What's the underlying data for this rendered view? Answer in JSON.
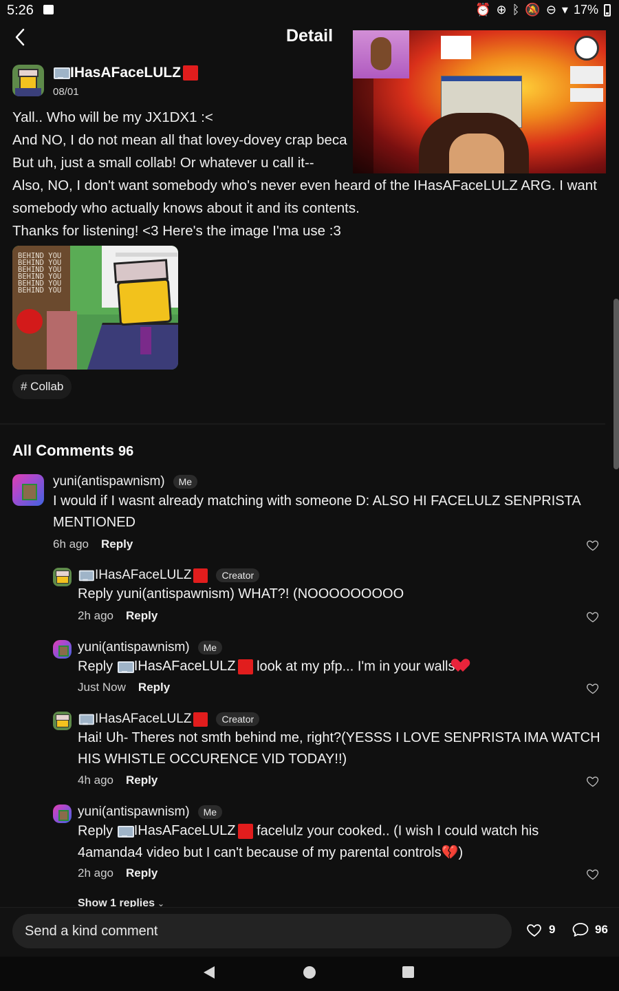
{
  "status_bar": {
    "time": "5:26",
    "battery": "17%",
    "icons": [
      "gallery-icon",
      "alarm-icon",
      "sync-icon",
      "bluetooth-icon",
      "bell-off-icon",
      "dnd-icon",
      "wifi-icon",
      "battery-icon"
    ]
  },
  "header": {
    "title": "Detail",
    "back_icon": "chevron-left-icon"
  },
  "post": {
    "author": "IHasAFaceLULZ",
    "date": "08/01",
    "lines": [
      "Yall.. Who will be my JX1DX1 :<",
      "And NO, I do not mean all that lovey-dovey crap beca",
      "But uh, just a small collab! Or whatever u call it--",
      "Also, NO, I don't want somebody who's never even heard of the IHasAFaceLULZ ARG. I want somebody who actually knows about it and its contents.",
      "Thanks for listening! <3 Here's the image I'ma use :3"
    ],
    "image_text": "BEHIND YOU\nBEHIND YOU\nBEHIND YOU\nBEHIND YOU\nBEHIND YOU\nBEHIND YOU",
    "tag": "# Collab"
  },
  "comments_section": {
    "title": "All Comments",
    "count": "96",
    "comments": [
      {
        "user": "yuni(antispawnism)",
        "badge": "Me",
        "text": "I would if I wasnt already matching with someone D: ALSO HI FACELULZ SENPRISTA MENTIONED",
        "time": "6h ago",
        "reply_label": "Reply"
      },
      {
        "user": "IHasAFaceLULZ",
        "badge": "Creator",
        "text": "Reply yuni(antispawnism) WHAT?! (NOOOOOOOOO",
        "time": "2h ago",
        "reply_label": "Reply"
      },
      {
        "user": "yuni(antispawnism)",
        "badge": "Me",
        "text_prefix": "Reply ",
        "mention": "IHasAFaceLULZ",
        "text_suffix": " look at my pfp... I'm in your walls",
        "time": "Just Now",
        "reply_label": "Reply"
      },
      {
        "user": "IHasAFaceLULZ",
        "badge": "Creator",
        "text": "Hai! Uh- Theres not smth behind me, right?(YESSS I LOVE SENPRISTA IMA WATCH HIS WHISTLE OCCURENCE VID TODAY!!)",
        "time": "4h ago",
        "reply_label": "Reply"
      },
      {
        "user": "yuni(antispawnism)",
        "badge": "Me",
        "text_prefix": "Reply ",
        "mention": "IHasAFaceLULZ",
        "text_suffix": " facelulz your cooked.. (I wish I could watch his 4amanda4 video but I can't because of my parental controls",
        "text_end": ")",
        "time": "2h ago",
        "reply_label": "Reply"
      }
    ],
    "show_replies": "Show 1 replies"
  },
  "bottom_bar": {
    "placeholder": "Send a kind comment",
    "likes": "9",
    "comments": "96"
  }
}
